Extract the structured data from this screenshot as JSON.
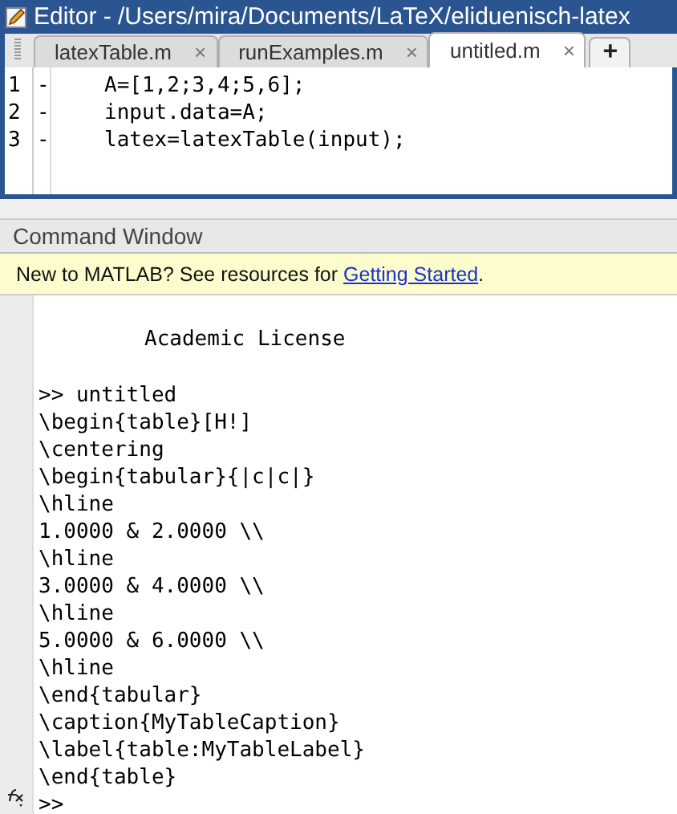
{
  "window": {
    "title": "Editor - /Users/mira/Documents/LaTeX/eliduenisch-latex"
  },
  "tabs": [
    {
      "label": "latexTable.m",
      "close": "×",
      "selected": false
    },
    {
      "label": "runExamples.m",
      "close": "×",
      "selected": false
    },
    {
      "label": "untitled.m",
      "close": "×",
      "selected": true
    }
  ],
  "new_tab": "+",
  "editor": {
    "lines": [
      {
        "number": "1",
        "marker": "-",
        "code": "A=[1,2;3,4;5,6];"
      },
      {
        "number": "2",
        "marker": "-",
        "code": "input.data=A;"
      },
      {
        "number": "3",
        "marker": "-",
        "code": "latex=latexTable(input);"
      }
    ]
  },
  "command_window": {
    "title": "Command Window",
    "banner": {
      "text": "New to MATLAB? See resources for ",
      "link": "Getting Started",
      "after": "."
    },
    "license": "Academic License",
    "lines": [
      ">> untitled",
      "\\begin{table}[H!]",
      "\\centering",
      "\\begin{tabular}{|c|c|}",
      "\\hline",
      "1.0000 & 2.0000 \\\\",
      "\\hline",
      "3.0000 & 4.0000 \\\\",
      "\\hline",
      "5.0000 & 6.0000 \\\\",
      "\\hline",
      "\\end{tabular}",
      "\\caption{MyTableCaption}",
      "\\label{table:MyTableLabel}",
      "\\end{table}"
    ],
    "prompt": ">>"
  }
}
